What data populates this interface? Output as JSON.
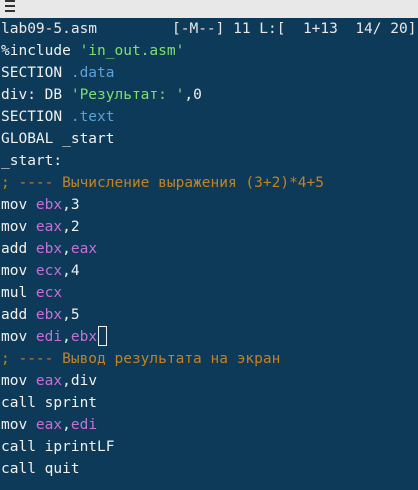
{
  "window": {
    "menu_icon": "hamburger-menu-icon"
  },
  "status": {
    "file": "lab09-5.asm",
    "mode_and_pos": "[-M--] 11 L:[  1+13  14/ 20]"
  },
  "colors": {
    "background": "#0e3a5a",
    "text": "#f0f0f0",
    "string": "#7ee06a",
    "section": "#5aa3d8",
    "register": "#c86fd6",
    "comment": "#c4821f"
  },
  "code": {
    "l1": {
      "a": "%include ",
      "b": "'in_out.asm'"
    },
    "l2": {
      "a": "SECTION ",
      "b": ".data"
    },
    "l3": {
      "a": "div: DB ",
      "b": "'Результат: '",
      "c": ",0"
    },
    "l4": {
      "a": "SECTION ",
      "b": ".text"
    },
    "l5": {
      "a": "GLOBAL _start"
    },
    "l6": {
      "a": "_start:"
    },
    "l7": {
      "a": "; ---- Вычисление выражения (3+2)*4+5"
    },
    "l8": {
      "a": "mov ",
      "b": "ebx",
      "c": ",3"
    },
    "l9": {
      "a": "mov ",
      "b": "eax",
      "c": ",2"
    },
    "l10": {
      "a": "add ",
      "b": "ebx",
      "c": ",",
      "d": "eax"
    },
    "l11": {
      "a": "mov ",
      "b": "ecx",
      "c": ",4"
    },
    "l12": {
      "a": "mul ",
      "b": "ecx"
    },
    "l13": {
      "a": "add ",
      "b": "ebx",
      "c": ",5"
    },
    "l14": {
      "a": "mov ",
      "b": "edi",
      "c": ",",
      "d": "ebx"
    },
    "l15": {
      "a": "; ---- Вывод результата на экран"
    },
    "l16": {
      "a": "mov ",
      "b": "eax",
      "c": ",div"
    },
    "l17": {
      "a": "call sprint"
    },
    "l18": {
      "a": "mov ",
      "b": "eax",
      "c": ",",
      "d": "edi"
    },
    "l19": {
      "a": "call iprintLF"
    },
    "l20": {
      "a": "call quit"
    }
  }
}
